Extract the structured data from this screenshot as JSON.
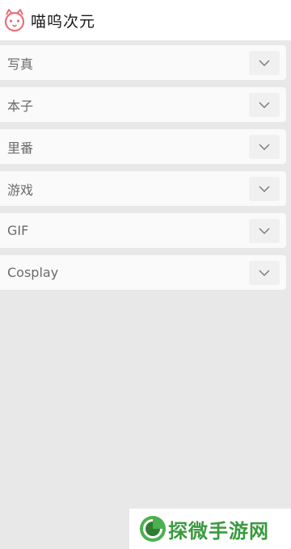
{
  "header": {
    "logo_text": "喵呜次元",
    "logo_icon": "cat-face-icon"
  },
  "menu": {
    "items": [
      {
        "label": "写真"
      },
      {
        "label": "本子"
      },
      {
        "label": "里番"
      },
      {
        "label": "游戏"
      },
      {
        "label": "GIF"
      },
      {
        "label": "Cosplay"
      }
    ],
    "expand_icon": "chevron-down-icon"
  },
  "watermark": {
    "text": "探微手游网",
    "icon": "leaf-logo-icon"
  },
  "colors": {
    "background": "#e8e8e8",
    "item_background": "#fafafa",
    "label": "#6b6b6b",
    "logo_accent": "#e8707a",
    "watermark_green": "#3a9a3e"
  }
}
